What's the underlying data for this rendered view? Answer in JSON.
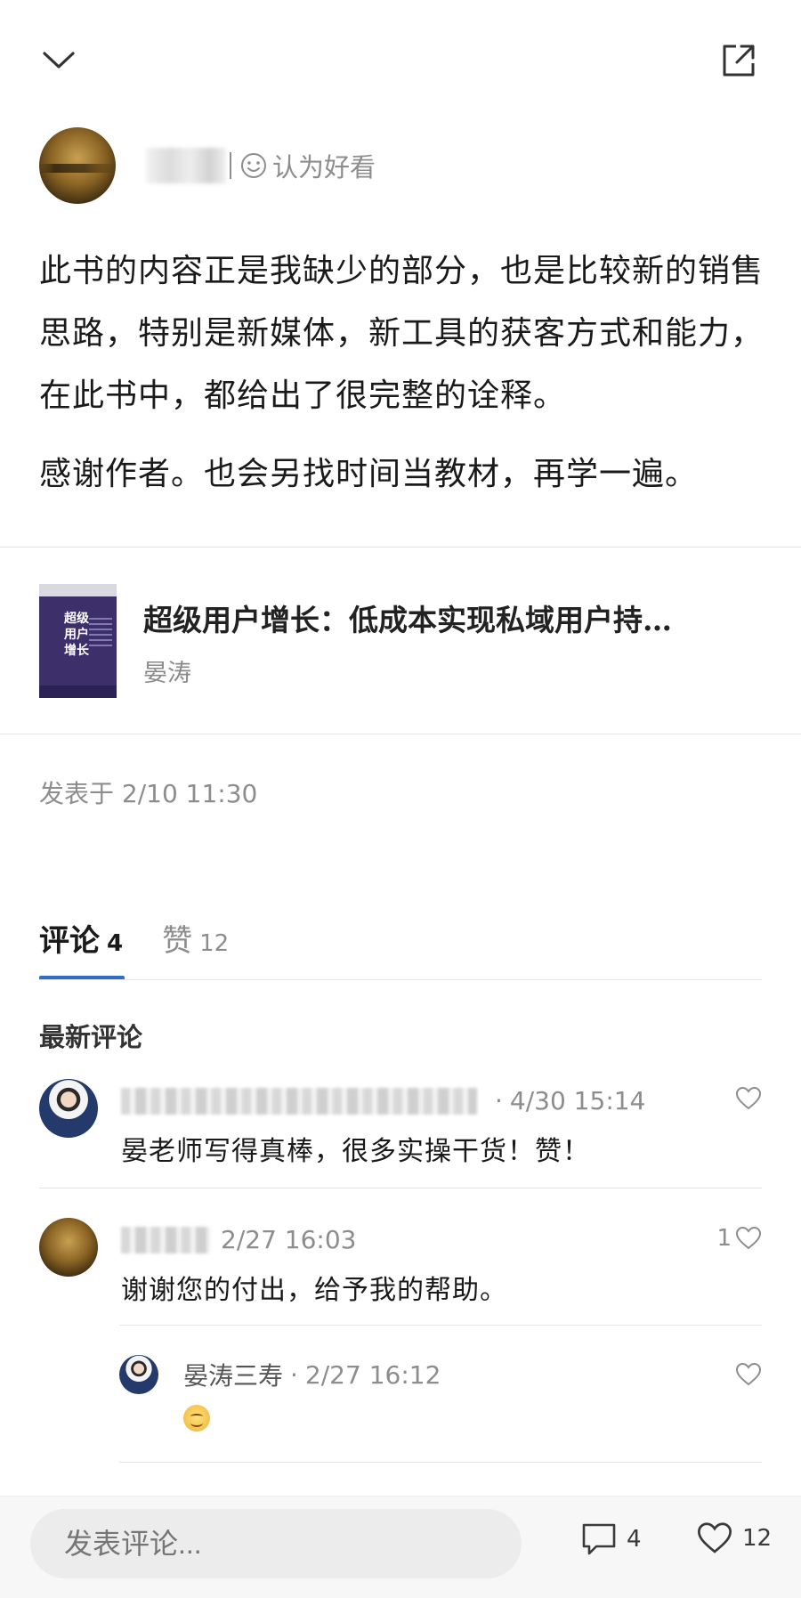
{
  "header": {
    "collapse_icon": "chevron-down-icon",
    "share_icon": "share-external-icon"
  },
  "author": {
    "rating_label": "认为好看",
    "rating_icon": "smile-icon"
  },
  "review": {
    "paragraphs": [
      "此书的内容正是我缺少的部分，也是比较新的销售思路，特别是新媒体，新工具的获客方式和能力，在此书中，都给出了很完整的诠释。",
      "感谢作者。也会另找时间当教材，再学一遍。"
    ]
  },
  "book": {
    "title": "超级用户增长：低成本实现私域用户持…",
    "author": "晏涛",
    "cover_text": "超级\n用户\n增长"
  },
  "post_time": "发表于 2/10 11:30",
  "tabs": [
    {
      "label": "评论",
      "count": "4",
      "active": true
    },
    {
      "label": "赞",
      "count": "12",
      "active": false
    }
  ],
  "comments_section_title": "最新评论",
  "comments": [
    {
      "time": "4/30 15:14",
      "text": "晏老师写得真棒，很多实操干货！赞！",
      "likes": ""
    },
    {
      "time": "2/27 16:03",
      "text": "谢谢您的付出，给予我的帮助。",
      "likes": "1"
    }
  ],
  "reply": {
    "name": "晏涛三寿",
    "time": "2/27 16:12",
    "content_icon": "smile-emoji-icon"
  },
  "bottom_bar": {
    "input_placeholder": "发表评论...",
    "comment_count": "4",
    "like_count": "12"
  },
  "colors": {
    "accent": "#2f6fbf",
    "muted": "#8d8d8d",
    "text": "#1a1a1a"
  }
}
